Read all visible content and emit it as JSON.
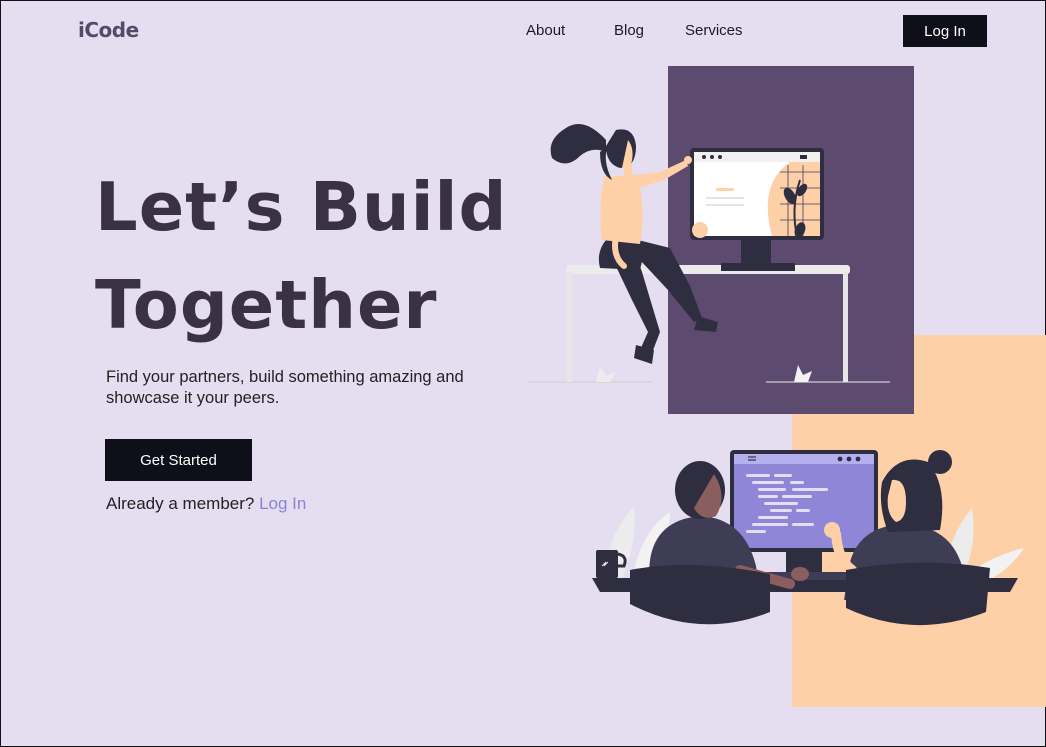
{
  "brand": {
    "logo_text": "iCode"
  },
  "nav": {
    "items": [
      {
        "label": "About"
      },
      {
        "label": "Blog"
      },
      {
        "label": "Services"
      }
    ],
    "login_label": "Log In"
  },
  "hero": {
    "title_line1": "Let’s Build",
    "title_line2": "Together",
    "subtitle": "Find your partners, build something amazing  and showcase it your peers.",
    "cta_label": "Get Started",
    "member_text": "Already a member?",
    "member_link": "Log In"
  },
  "illustrations": {
    "top": "woman-at-monitor-illustration",
    "bottom": "two-people-coding-illustration"
  },
  "colors": {
    "background": "#e4def0",
    "dark_purple": "#5c4b6e",
    "peach": "#fdd0a8",
    "button": "#0e0f18",
    "title": "#3a3145",
    "link": "#8b82d9",
    "screen_code": "#8f86d8"
  }
}
